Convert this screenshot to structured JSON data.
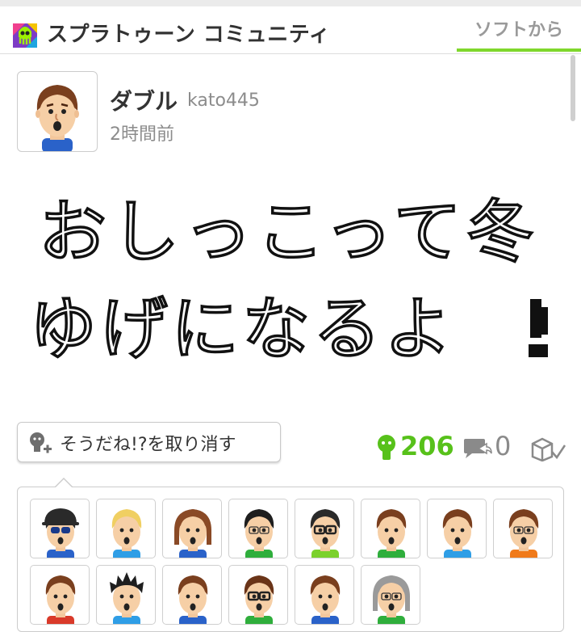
{
  "header": {
    "community_title": "スプラトゥーン コミュニティ",
    "tab_label": "ソフトから",
    "accent_color": "#7fd72c"
  },
  "post": {
    "author_name": "ダブル",
    "author_id": "kato445",
    "timestamp": "2時間前",
    "drawing_text": "おしっこって冬ゆげになるよ!"
  },
  "actions": {
    "yeah_button_label": "そうだね!?を取り消す",
    "yeah_count": "206",
    "reply_count": "0",
    "yeah_color": "#57c11a"
  },
  "empathy_miis": [
    {
      "icon": "mii-avatar-cap-sunglasses"
    },
    {
      "icon": "mii-avatar-blonde"
    },
    {
      "icon": "mii-avatar-long-hair"
    },
    {
      "icon": "mii-avatar-black-hair-glasses"
    },
    {
      "icon": "mii-avatar-glasses"
    },
    {
      "icon": "mii-avatar-brown-hair"
    },
    {
      "icon": "mii-avatar-brown-hair"
    },
    {
      "icon": "mii-avatar-orange-shirt"
    },
    {
      "icon": "mii-avatar-brown-hair"
    },
    {
      "icon": "mii-avatar-spiky-hair"
    },
    {
      "icon": "mii-avatar-brown-hair"
    },
    {
      "icon": "mii-avatar-brown-hair-glasses"
    },
    {
      "icon": "mii-avatar-brown-hair"
    },
    {
      "icon": "mii-avatar-gray-hair-glasses"
    }
  ]
}
